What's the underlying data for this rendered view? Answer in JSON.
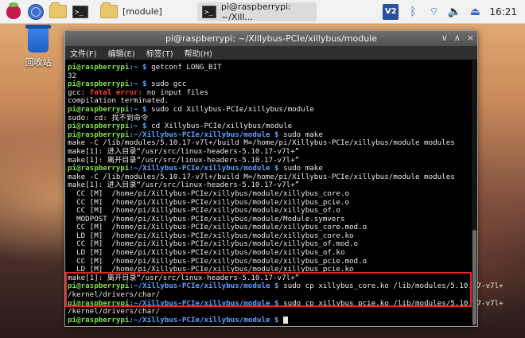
{
  "taskbar": {
    "tasks": [
      {
        "label": "[module]"
      },
      {
        "label": "pi@raspberrypi: ~/Xill..."
      }
    ],
    "tray": {
      "vnc_label": "V2",
      "bluetooth": "ᛒ",
      "wifi": "⌔",
      "volume": "🔈",
      "eject": "⏏",
      "clock": "16:21"
    }
  },
  "desktop": {
    "trash_label": "回收站"
  },
  "window": {
    "title": "pi@raspberrypi: ~/Xillybus-PCIe/xillybus/module",
    "controls": {
      "minimize": "∨",
      "maximize": "∧",
      "close": "×"
    },
    "menu": [
      {
        "label": "文件(F)"
      },
      {
        "label": "编辑(E)"
      },
      {
        "label": "标签(T)"
      },
      {
        "label": "帮助(H)"
      }
    ]
  },
  "terminal": {
    "prompt_user": "pi@raspberrypi",
    "prompt_home": ":~ $ ",
    "prompt_module_path": ":~/Xillybus-PCIe/xillybus/module $ ",
    "lines": [
      {
        "t": "cmd",
        "path": "home",
        "text": "getconf LONG_BIT"
      },
      {
        "t": "out",
        "text": "32"
      },
      {
        "t": "cmd",
        "path": "home",
        "text": "sudo gcc"
      },
      {
        "t": "err",
        "pre": "gcc: ",
        "red": "fatal error: ",
        "text": "no input files"
      },
      {
        "t": "out",
        "text": "compilation terminated."
      },
      {
        "t": "cmd",
        "path": "home",
        "text": "sudo cd Xillybus-PCIe/xillybus/module"
      },
      {
        "t": "out",
        "text": "sudo: cd: 找不到命令"
      },
      {
        "t": "cmd",
        "path": "home",
        "text": "cd Xillybus-PCIe/xillybus/module"
      },
      {
        "t": "cmd",
        "path": "module",
        "text": "sudo make"
      },
      {
        "t": "out",
        "text": "make -C /lib/modules/5.10.17-v7l+/build M=/home/pi/Xillybus-PCIe/xillybus/module modules"
      },
      {
        "t": "out",
        "text": "make[1]: 进入目录“/usr/src/linux-headers-5.10.17-v7l+”"
      },
      {
        "t": "out",
        "text": "make[1]: 离开目录“/usr/src/linux-headers-5.10.17-v7l+”"
      },
      {
        "t": "cmd",
        "path": "module",
        "text": "sudo make"
      },
      {
        "t": "out",
        "text": "make -C /lib/modules/5.10.17-v7l+/build M=/home/pi/Xillybus-PCIe/xillybus/module modules"
      },
      {
        "t": "out",
        "text": "make[1]: 进入目录“/usr/src/linux-headers-5.10.17-v7l+”"
      },
      {
        "t": "out",
        "text": "  CC [M]  /home/pi/Xillybus-PCIe/xillybus/module/xillybus_core.o"
      },
      {
        "t": "out",
        "text": "  CC [M]  /home/pi/Xillybus-PCIe/xillybus/module/xillybus_pcie.o"
      },
      {
        "t": "out",
        "text": "  CC [M]  /home/pi/Xillybus-PCIe/xillybus/module/xillybus_of.o"
      },
      {
        "t": "out",
        "text": "  MODPOST /home/pi/Xillybus-PCIe/xillybus/module/Module.symvers"
      },
      {
        "t": "out",
        "text": "  CC [M]  /home/pi/Xillybus-PCIe/xillybus/module/xillybus_core.mod.o"
      },
      {
        "t": "out",
        "text": "  LD [M]  /home/pi/Xillybus-PCIe/xillybus/module/xillybus_core.ko"
      },
      {
        "t": "out",
        "text": "  CC [M]  /home/pi/Xillybus-PCIe/xillybus/module/xillybus_of.mod.o"
      },
      {
        "t": "out",
        "text": "  LD [M]  /home/pi/Xillybus-PCIe/xillybus/module/xillybus_of.ko"
      },
      {
        "t": "out",
        "text": "  CC [M]  /home/pi/Xillybus-PCIe/xillybus/module/xillybus_pcie.mod.o"
      },
      {
        "t": "out",
        "text": "  LD [M]  /home/pi/Xillybus-PCIe/xillybus/module/xillybus_pcie.ko"
      },
      {
        "t": "out",
        "text": "make[1]: 离开目录“/usr/src/linux-headers-5.10.17-v7l+”"
      },
      {
        "t": "cmd",
        "path": "module",
        "text": "sudo cp xillybus_core.ko /lib/modules/5.10.17-v7l+"
      },
      {
        "t": "out",
        "text": "/kernel/drivers/char/"
      },
      {
        "t": "cmd",
        "path": "module",
        "text": "sudo cp xillybus_pcie.ko /lib/modules/5.10.17-v7l+"
      },
      {
        "t": "out",
        "text": "/kernel/drivers/char/"
      },
      {
        "t": "cmd",
        "path": "module",
        "text": ""
      }
    ]
  }
}
